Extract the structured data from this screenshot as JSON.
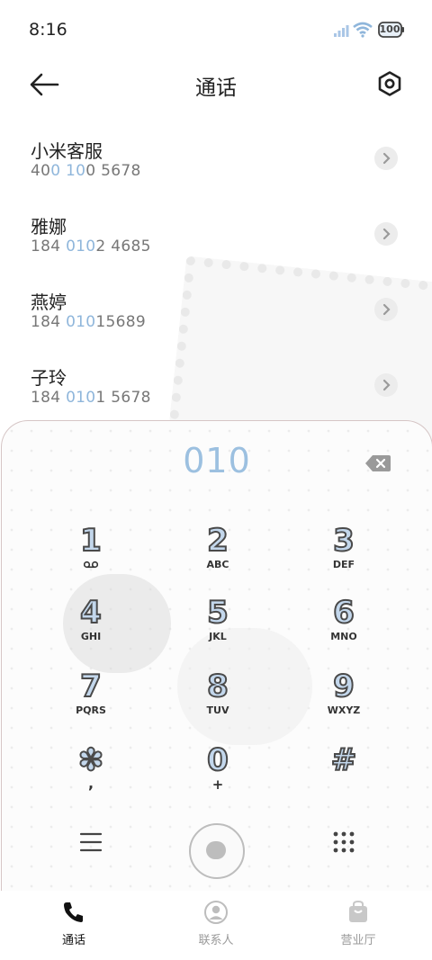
{
  "status_bar": {
    "time": "8:16",
    "battery": "100",
    "icons": [
      "signal-icon",
      "wifi-icon",
      "battery-icon"
    ]
  },
  "header": {
    "title": "通话",
    "icons": [
      "back-arrow-icon",
      "settings-icon"
    ]
  },
  "contacts": [
    {
      "name": "小米客服",
      "number_parts": [
        "40",
        "0 10",
        "0 5678"
      ]
    },
    {
      "name": "雅娜",
      "number_parts": [
        "184 ",
        "010",
        "2 4685"
      ]
    },
    {
      "name": "燕婷",
      "number_parts": [
        "184 ",
        "010",
        "15689"
      ]
    },
    {
      "name": "子玲",
      "number_parts": [
        "184 ",
        "010",
        "1 5678"
      ]
    }
  ],
  "dialer": {
    "input": "010",
    "keys": [
      {
        "digit": "1",
        "sub": "voicemail-icon"
      },
      {
        "digit": "2",
        "sub": "ABC"
      },
      {
        "digit": "3",
        "sub": "DEF"
      },
      {
        "digit": "4",
        "sub": "GHI"
      },
      {
        "digit": "5",
        "sub": "JKL"
      },
      {
        "digit": "6",
        "sub": "MNO"
      },
      {
        "digit": "7",
        "sub": "PQRS"
      },
      {
        "digit": "8",
        "sub": "TUV"
      },
      {
        "digit": "9",
        "sub": "WXYZ"
      },
      {
        "digit": "✽",
        "sub": ","
      },
      {
        "digit": "0",
        "sub": "+"
      },
      {
        "digit": "#",
        "sub": ""
      }
    ]
  },
  "bottom_nav": {
    "items": [
      {
        "label": "通话",
        "icon": "phone-icon",
        "active": true
      },
      {
        "label": "联系人",
        "icon": "contacts-icon",
        "active": false
      },
      {
        "label": "营业厅",
        "icon": "shopping-bag-icon",
        "active": false
      }
    ]
  },
  "colors": {
    "accent": "#8fb6db",
    "digit_fill": "#c3d7ec",
    "text": "#222222",
    "muted": "#777777"
  }
}
